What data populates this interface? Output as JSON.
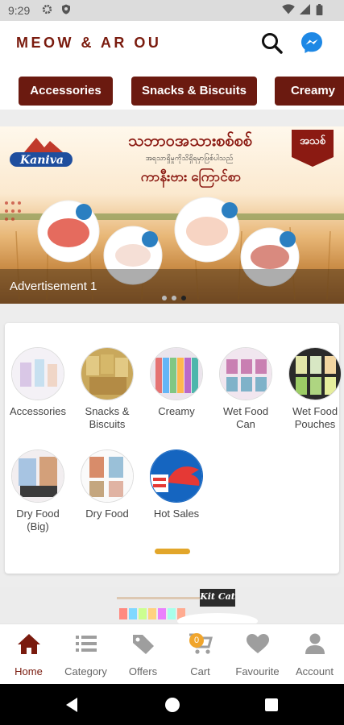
{
  "status_bar": {
    "time": "9:29"
  },
  "header": {
    "title": "MEOW & AR OU"
  },
  "chips": [
    {
      "label": "Accessories"
    },
    {
      "label": "Snacks & Biscuits"
    },
    {
      "label": "Creamy"
    }
  ],
  "banner": {
    "brand": "Kaniva",
    "headline": "သဘာဝအသားစစ်စစ်",
    "subline": "အရသာရှိမှုကိုသိရှိရမှာဖြစ်ပါသည်",
    "benefit": "ကာနီးဗား ကြောင်စာ",
    "badge": "အသစ်",
    "caption": "Advertisement 1",
    "active_dot": 3,
    "dot_count": 3
  },
  "categories": [
    {
      "label": "Accessories"
    },
    {
      "label": "Snacks & Biscuits"
    },
    {
      "label": "Creamy"
    },
    {
      "label": "Wet Food Can"
    },
    {
      "label": "Wet Food Pouches"
    },
    {
      "label": "Dry Food (Big)"
    },
    {
      "label": "Dry Food"
    },
    {
      "label": "Hot Sales"
    }
  ],
  "promo": {
    "brand": "Kit Cat"
  },
  "bottom_nav": [
    {
      "label": "Home",
      "icon": "home-icon",
      "active": true
    },
    {
      "label": "Category",
      "icon": "list-icon"
    },
    {
      "label": "Offers",
      "icon": "tag-icon"
    },
    {
      "label": "Cart",
      "icon": "cart-icon",
      "badge": "0"
    },
    {
      "label": "Favourite",
      "icon": "heart-icon"
    },
    {
      "label": "Account",
      "icon": "person-icon"
    }
  ],
  "colors": {
    "brand": "#7a1b0e",
    "chip": "#6b1a10",
    "accent": "#f0a52c",
    "messenger": "#1e88e5"
  }
}
